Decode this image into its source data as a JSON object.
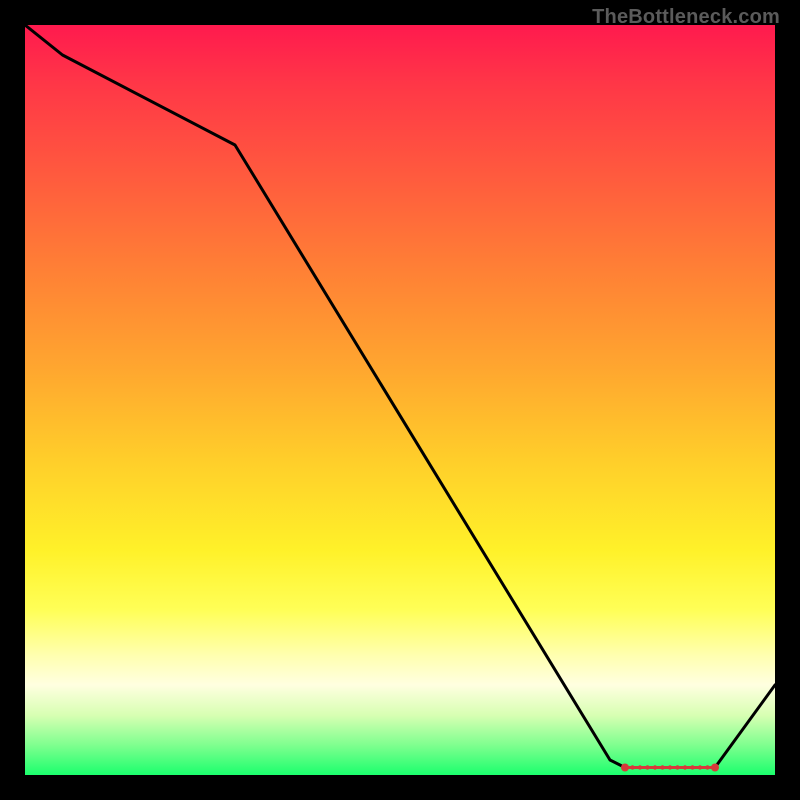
{
  "watermark": "TheBottleneck.com",
  "chart_data": {
    "type": "line",
    "title": "",
    "xlabel": "",
    "ylabel": "",
    "xlim": [
      0,
      100
    ],
    "ylim": [
      0,
      100
    ],
    "x": [
      0,
      5,
      28,
      78,
      80,
      92,
      100
    ],
    "values": [
      100,
      96,
      84,
      2,
      1,
      1,
      12
    ],
    "annotations": [],
    "optimal_band": {
      "x_start": 80,
      "x_end": 92,
      "y": 1
    }
  }
}
